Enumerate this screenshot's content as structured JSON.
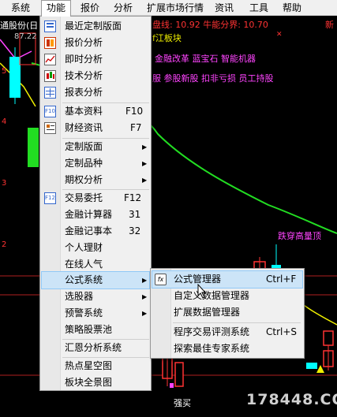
{
  "menubar": {
    "items": [
      "系统",
      "功能",
      "报价",
      "分析",
      "扩展市场行情",
      "资讯",
      "工具",
      "帮助"
    ],
    "active": "功能"
  },
  "chart": {
    "stock_title": "通股份(日",
    "price_label": "87.22",
    "tick_labels": [
      "5",
      "4",
      "3",
      "2"
    ],
    "info_line1": "盘线: 10.92  牛能分界: 10.70",
    "sector": "f江板块",
    "concepts": "金融改革 蓝宝石 智能机器",
    "concepts2": "服 参股新股 扣非亏损 员工持股",
    "signal": "跌穿高量顶",
    "buy_label": "强买",
    "watermark": "178448.COM",
    "side_marks": [
      "新",
      "新"
    ],
    "colors": {
      "red": "#ff3333",
      "yellow": "#f0f000",
      "green": "#22dd22",
      "magenta": "#ff44ff",
      "cyan": "#00ffff",
      "blue": "#4a6fff"
    }
  },
  "function_menu": {
    "items": [
      {
        "label": "最近定制版面",
        "icon": "recent-layout-icon"
      },
      {
        "label": "报价分析",
        "icon": "quote-grid-icon"
      },
      {
        "label": "即时分析",
        "icon": "realtime-line-icon"
      },
      {
        "label": "技术分析",
        "icon": "candlestick-icon"
      },
      {
        "label": "报表分析",
        "icon": "report-table-icon"
      },
      {
        "label": "基本资料",
        "shortcut": "F10",
        "icon": "f10-icon"
      },
      {
        "label": "财经资讯",
        "shortcut": "F7",
        "icon": "news-icon"
      },
      {
        "label": "定制版面",
        "submenu": true
      },
      {
        "label": "定制品种",
        "submenu": true
      },
      {
        "label": "期权分析",
        "submenu": true
      },
      {
        "label": "交易委托",
        "shortcut": "F12",
        "icon": "f12-icon"
      },
      {
        "label": "金融计算器",
        "shortcut": "31"
      },
      {
        "label": "金融记事本",
        "shortcut": "32"
      },
      {
        "label": "个人理财"
      },
      {
        "label": "在线人气"
      },
      {
        "label": "公式系统",
        "submenu": true,
        "highlighted": true
      },
      {
        "label": "选股器",
        "submenu": true
      },
      {
        "label": "预警系统",
        "submenu": true
      },
      {
        "label": "策略股票池"
      },
      {
        "label": "汇恩分析系统"
      },
      {
        "label": "热点星空图"
      },
      {
        "label": "板块全景图"
      }
    ]
  },
  "formula_submenu": {
    "items": [
      {
        "label": "公式管理器",
        "shortcut": "Ctrl+F",
        "icon": "fx-icon",
        "highlighted": true
      },
      {
        "label": "自定义数据管理器"
      },
      {
        "label": "扩展数据管理器"
      },
      {
        "label": "程序交易评测系统",
        "shortcut": "Ctrl+S"
      },
      {
        "label": "探索最佳专家系统"
      }
    ]
  }
}
